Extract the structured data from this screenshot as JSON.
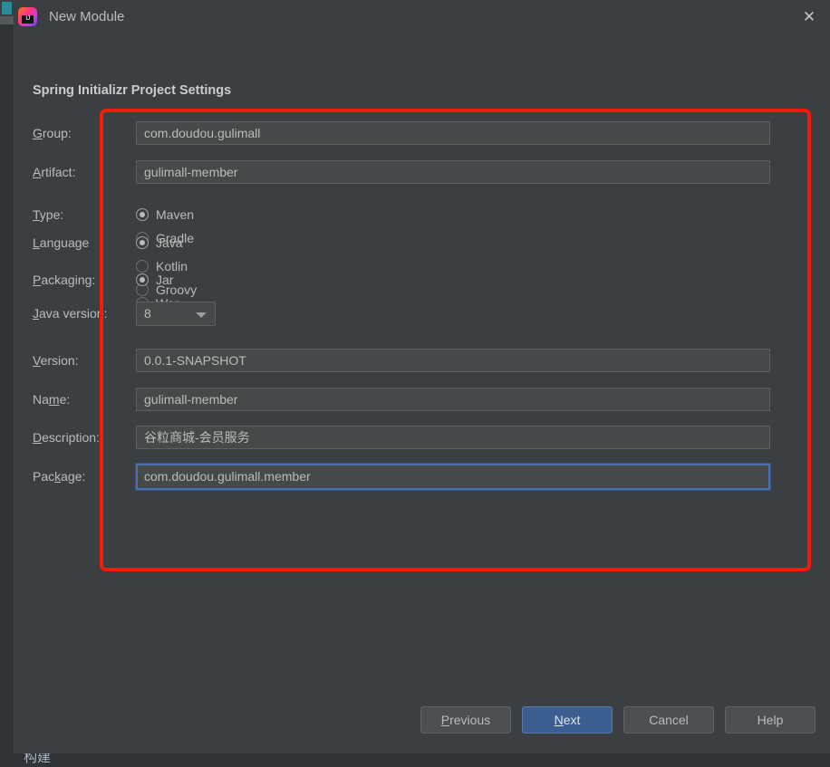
{
  "window": {
    "title": "New Module",
    "app_icon": "intellij-idea-logo-icon",
    "icon_text": "IJ",
    "close_icon": "✕"
  },
  "background": {
    "bottom_text": "构建"
  },
  "dialog": {
    "section_title": "Spring Initializr Project Settings"
  },
  "annotation": {
    "color": "#f61a0a",
    "shape": "rectangle-highlight"
  },
  "form": {
    "group": {
      "label_pre": "",
      "label_mn": "G",
      "label_post": "roup:",
      "value": "com.doudou.gulimall"
    },
    "artifact": {
      "label_pre": "",
      "label_mn": "A",
      "label_post": "rtifact:",
      "value": "gulimall-member"
    },
    "type": {
      "label_pre": "",
      "label_mn": "T",
      "label_post": "ype:",
      "options": [
        {
          "label": "Maven",
          "checked": true
        },
        {
          "label": "Gradle",
          "checked": false
        }
      ]
    },
    "language": {
      "label_pre": "",
      "label_mn": "L",
      "label_post": "anguage",
      "options": [
        {
          "label": "Java",
          "checked": true
        },
        {
          "label": "Kotlin",
          "checked": false
        },
        {
          "label": "Groovy",
          "checked": false
        }
      ]
    },
    "packaging": {
      "label_pre": "",
      "label_mn": "P",
      "label_post": "ackaging:",
      "options": [
        {
          "label": "Jar",
          "checked": true
        },
        {
          "label": "War",
          "checked": false
        }
      ]
    },
    "java_version": {
      "label_pre": "",
      "label_mn": "J",
      "label_post": "ava version:",
      "value": "8",
      "arrow_icon": "chevron-down-icon"
    },
    "version": {
      "label_pre": "",
      "label_mn": "V",
      "label_post": "ersion:",
      "value": "0.0.1-SNAPSHOT"
    },
    "name": {
      "label_pre": "Na",
      "label_mn": "m",
      "label_post": "e:",
      "value": "gulimall-member"
    },
    "description": {
      "label_pre": "",
      "label_mn": "D",
      "label_post": "escription:",
      "value": "谷粒商城-会员服务"
    },
    "package": {
      "label_pre": "Pac",
      "label_mn": "k",
      "label_post": "age:",
      "value": "com.doudou.gulimall.member",
      "focused": true
    }
  },
  "footer": {
    "buttons": [
      {
        "pre": "",
        "mn": "P",
        "post": "revious",
        "primary": false
      },
      {
        "pre": "",
        "mn": "N",
        "post": "ext",
        "primary": true
      },
      {
        "pre": "Cancel",
        "mn": "",
        "post": "",
        "primary": false
      },
      {
        "pre": "Help",
        "mn": "",
        "post": "",
        "primary": false
      }
    ]
  }
}
